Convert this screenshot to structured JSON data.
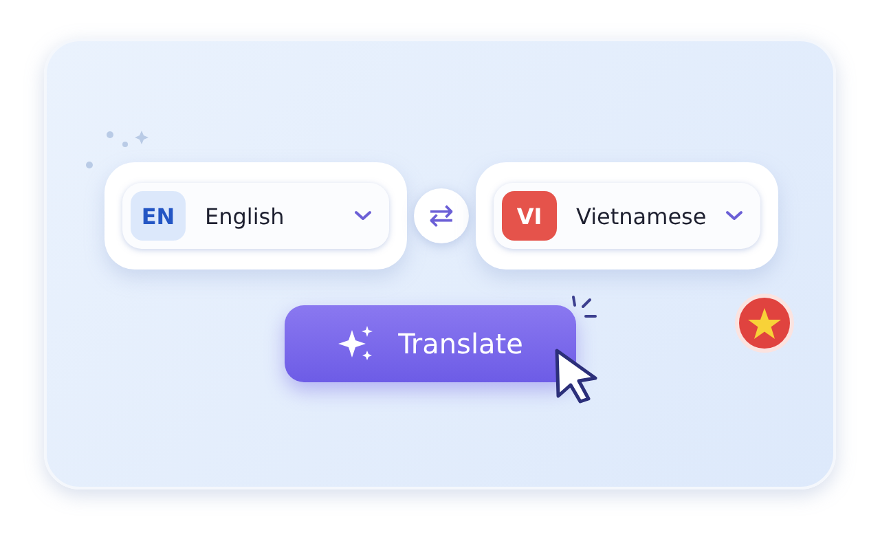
{
  "language_selectors": [
    {
      "code": "EN",
      "name": "English",
      "color": "#dce8fb"
    },
    {
      "code": "VI",
      "name": "Vietnamese",
      "color": "#e5534b"
    }
  ],
  "swap_button": {
    "label": "⇄"
  },
  "translate_button": {
    "label": "Translate"
  }
}
